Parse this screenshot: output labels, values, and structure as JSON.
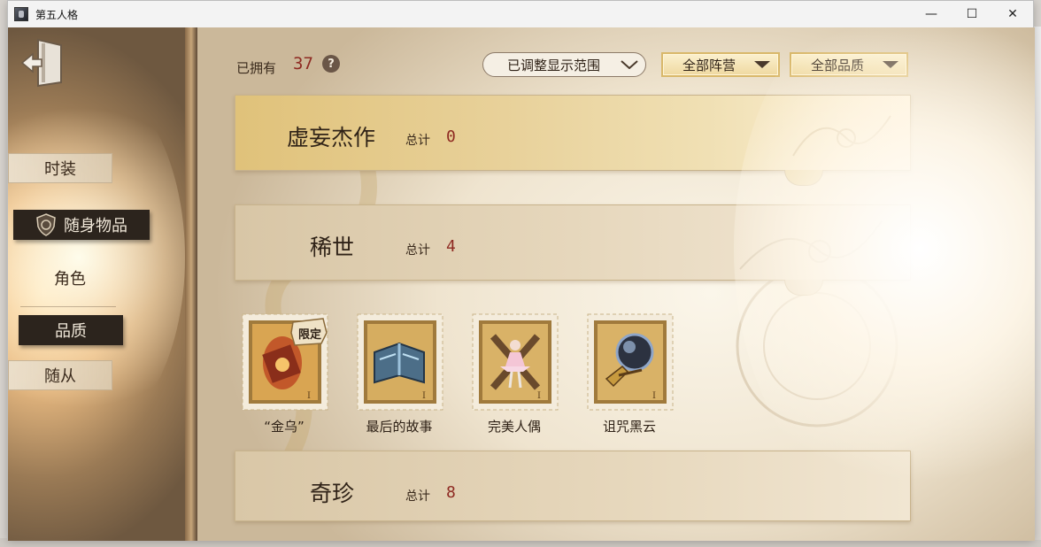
{
  "window": {
    "title": "第五人格",
    "minimize": "—",
    "maximize": "☐",
    "close": "✕"
  },
  "sidebar": {
    "items": [
      {
        "label": "时装",
        "state": "plain"
      },
      {
        "label": "随身物品",
        "state": "active",
        "icon": "shield-icon"
      },
      {
        "label": "角色",
        "state": "text"
      },
      {
        "label": "品质",
        "state": "active"
      },
      {
        "label": "随从",
        "state": "plain"
      }
    ]
  },
  "header": {
    "owned_label": "已拥有",
    "owned_count": "37",
    "help": "?",
    "range_dropdown": "已调整显示范围",
    "faction_dropdown": "全部阵营",
    "quality_dropdown": "全部品质"
  },
  "sections": [
    {
      "title": "虚妄杰作",
      "total_label": "总计",
      "total": "0"
    },
    {
      "title": "稀世",
      "total_label": "总计",
      "total": "4"
    },
    {
      "title": "奇珍",
      "total_label": "总计",
      "total": "8"
    }
  ],
  "items": [
    {
      "label": "“金乌”",
      "badge": "限定",
      "icon": "golden-crow-lantern-icon"
    },
    {
      "label": "最后的故事",
      "icon": "storybook-icon"
    },
    {
      "label": "完美人偶",
      "icon": "ballerina-doll-icon"
    },
    {
      "label": "诅咒黑云",
      "icon": "dark-orb-icon"
    }
  ],
  "colors": {
    "accent_red": "#8e2a22",
    "text_dark": "#2f2217",
    "nav_active_bg": "#2c241d",
    "gold_banner": "#e0c27a"
  }
}
